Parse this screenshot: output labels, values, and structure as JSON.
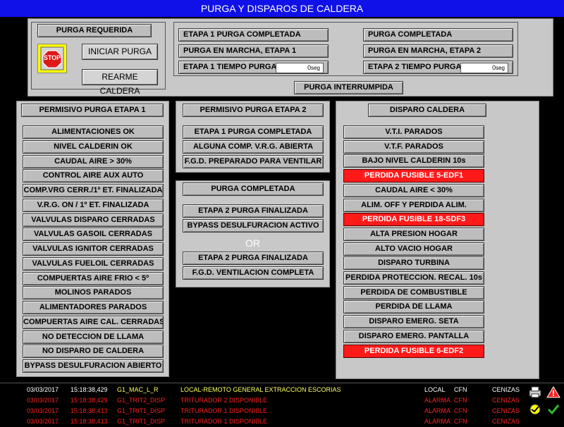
{
  "title": "PURGA Y DISPAROS DE CALDERA",
  "colors": {
    "title_bg": "#1010e8",
    "panel_bg": "#c8c8c8",
    "alarm_red": "#ff1a1a",
    "stop_red": "#e01818",
    "stop_border": "#ffff00",
    "alarm_text_red": "#ff2020",
    "alarm_text_white": "#ffffff",
    "alarm_text_yellow": "#ffff66"
  },
  "purga_box": {
    "title": "PURGA REQUERIDA",
    "stop_text": "STOP",
    "iniciar": "INICIAR PURGA",
    "rearme": "REARME CALDERA"
  },
  "status_left": [
    {
      "text": "ETAPA 1 PURGA COMPLETADA"
    },
    {
      "text": "PURGA EN MARCHA, ETAPA 1"
    },
    {
      "text": "ETAPA 1 TIEMPO PURGA",
      "value": "0",
      "unit": "seg"
    }
  ],
  "status_right": [
    {
      "text": "PURGA COMPLETADA"
    },
    {
      "text": "PURGA EN MARCHA, ETAPA 2"
    },
    {
      "text": "ETAPA 2 TIEMPO PURGA",
      "value": "0",
      "unit": "seg"
    }
  ],
  "purga_interrumpida": "PURGA INTERRUMPIDA",
  "permisivo1": {
    "title": "PERMISIVO PURGA ETAPA 1",
    "items": [
      "ALIMENTACIONES OK",
      "NIVEL CALDERIN OK",
      "CAUDAL AIRE > 30%",
      "CONTROL AIRE AUX AUTO",
      "COMP.VRG CERR./1º ET. FINALIZADA",
      "V.R.G. ON / 1º ET. FINALIZADA",
      "VALVULAS DISPARO CERRADAS",
      "VALVULAS GASOIL CERRADAS",
      "VALVULAS IGNITOR CERRADAS",
      "VALVULAS FUELOIL CERRADAS",
      "COMPUERTAS AIRE FRIO < 5º",
      "MOLINOS PARADOS",
      "ALIMENTADORES PARADOS",
      "COMPUERTAS AIRE CAL. CERRADAS",
      "NO DETECCION DE LLAMA",
      "NO DISPARO DE CALDERA",
      "BYPASS DESULFURACION ABIERTO"
    ]
  },
  "permisivo2": {
    "title": "PERMISIVO PURGA ETAPA 2",
    "items": [
      "ETAPA 1 PURGA COMPLETADA",
      "ALGUNA COMP. V.R.G. ABIERTA",
      "F.G.D. PREPARADO PARA VENTILAR"
    ]
  },
  "purga_completada": {
    "title": "PURGA COMPLETADA",
    "group1": [
      "ETAPA 2 PURGA FINALIZADA",
      "BYPASS DESULFURACION ACTIVO"
    ],
    "or": "OR",
    "group2": [
      "ETAPA 2 PURGA FINALIZADA",
      "F.G.D. VENTILACION COMPLETA"
    ]
  },
  "disparo": {
    "title": "DISPARO CALDERA",
    "items": [
      {
        "text": "V.T.I. PARADOS",
        "alarm": false
      },
      {
        "text": "V.T.F. PARADOS",
        "alarm": false
      },
      {
        "text": "BAJO NIVEL CALDERIN 10s",
        "alarm": false
      },
      {
        "text": "PERDIDA FUSIBLE 5-EDF1",
        "alarm": true
      },
      {
        "text": "CAUDAL AIRE < 30%",
        "alarm": false
      },
      {
        "text": "ALIM. OFF Y PERDIDA ALIM.",
        "alarm": false
      },
      {
        "text": "PERDIDA FUSIBLE 18-SDF3",
        "alarm": true
      },
      {
        "text": "ALTA PRESION HOGAR",
        "alarm": false
      },
      {
        "text": "ALTO VACIO HOGAR",
        "alarm": false
      },
      {
        "text": "DISPARO TURBINA",
        "alarm": false
      },
      {
        "text": "PERDIDA PROTECCION. RECAL. 10s",
        "alarm": false
      },
      {
        "text": "PERDIDA DE COMBUSTIBLE",
        "alarm": false
      },
      {
        "text": "PERDIDA DE LLAMA",
        "alarm": false
      },
      {
        "text": "DISPARO EMERG. SETA",
        "alarm": false
      },
      {
        "text": "DISPARO EMERG. PANTALLA",
        "alarm": false
      },
      {
        "text": "PERDIDA FUSIBLE 6-EDF2",
        "alarm": true
      }
    ]
  },
  "alarms": [
    {
      "date": "03/03/2017",
      "time": "15:18:38,429",
      "tag": "G1_MAC_L_R",
      "desc": "LOCAL-REMOTO GENERAL EXTRACCION ESCORIAS",
      "state": "LOCAL",
      "ack": "CFN",
      "area": "CENIZAS",
      "color": "yellow"
    },
    {
      "date": "03/03/2017",
      "time": "15:18:38,429",
      "tag": "G1_TRIT2_DISP",
      "desc": "TRITURADOR 2 DISPONIBLE",
      "state": "ALARMA",
      "ack": "CFN",
      "area": "CENIZAS",
      "color": "red"
    },
    {
      "date": "03/03/2017",
      "time": "15:18:38,413",
      "tag": "G1_TRIT1_DISP",
      "desc": "TRITURADOR 1 DISPONIBLE",
      "state": "ALARMA",
      "ack": "CFN",
      "area": "CENIZAS",
      "color": "red"
    },
    {
      "date": "03/03/2017",
      "time": "15:18:38,413",
      "tag": "G1_TRIT1_DISP",
      "desc": "TRITURADOR 1 DISPONIBLE",
      "state": "ALARMA",
      "ack": "CFN",
      "area": "CENIZAS",
      "color": "red"
    }
  ]
}
